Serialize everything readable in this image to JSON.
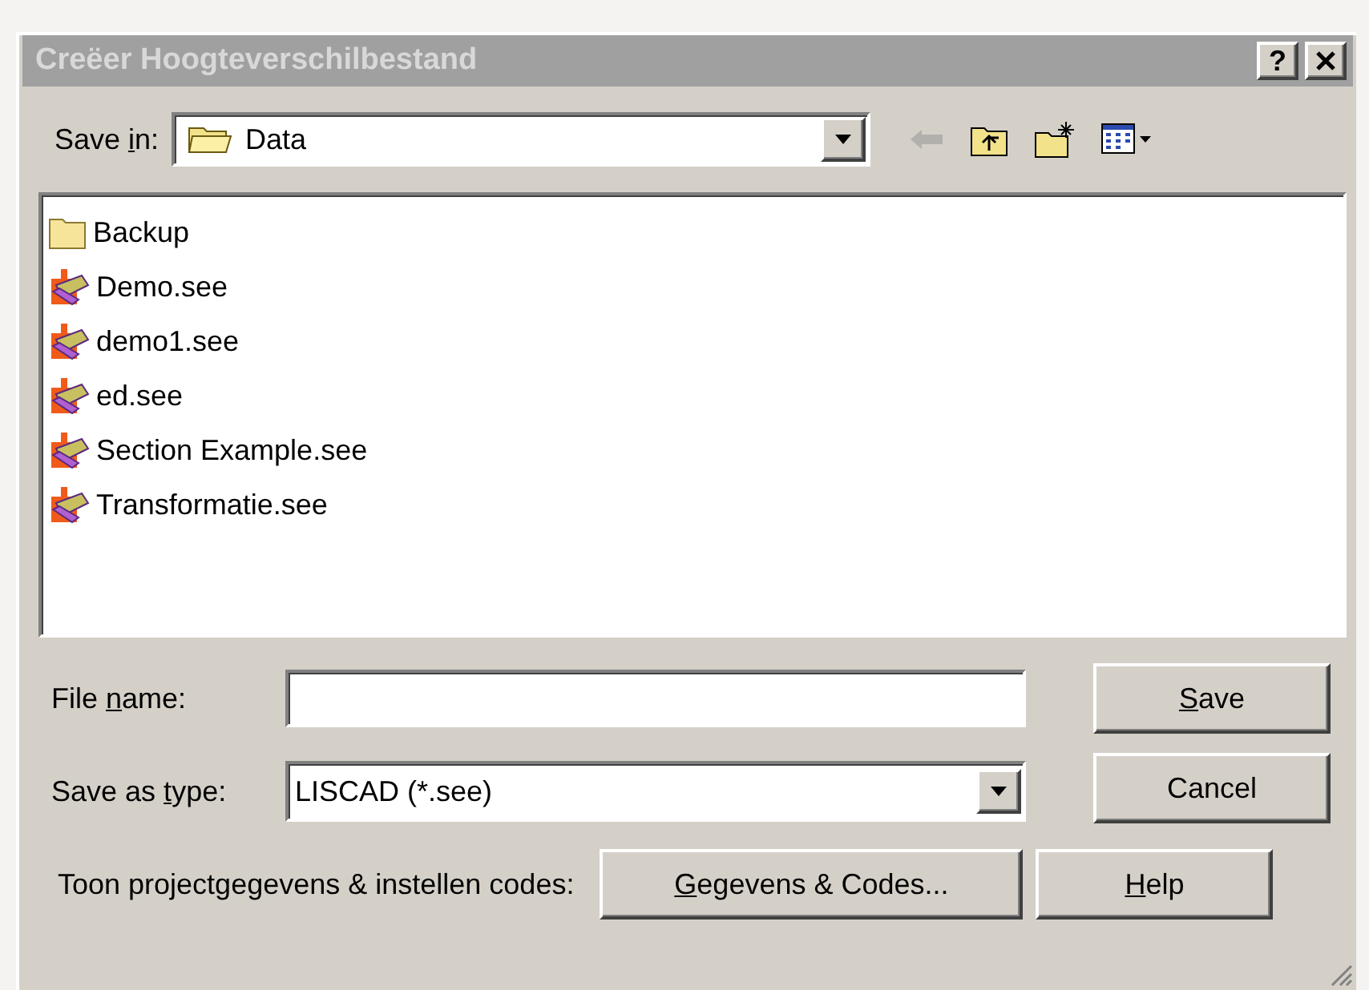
{
  "window": {
    "title": "Creëer Hoogteverschilbestand",
    "help": "?"
  },
  "save_in": {
    "label": {
      "pre": "Save ",
      "key": "i",
      "post": "n:"
    },
    "value": "Data"
  },
  "toolbar": [
    {
      "kind": "back",
      "disabled": true
    },
    {
      "kind": "up",
      "disabled": false
    },
    {
      "kind": "new_folder",
      "disabled": false
    },
    {
      "kind": "views",
      "disabled": false
    }
  ],
  "files": [
    {
      "name": "Backup",
      "kind": "folder"
    },
    {
      "name": "Demo.see",
      "kind": "file"
    },
    {
      "name": "demo1.see",
      "kind": "file"
    },
    {
      "name": "ed.see",
      "kind": "file"
    },
    {
      "name": "Section Example.see",
      "kind": "file"
    },
    {
      "name": "Transformatie.see",
      "kind": "file"
    }
  ],
  "file_name": {
    "label": {
      "pre": "File ",
      "key": "n",
      "post": "ame:"
    }
  },
  "save_as_type": {
    "label": {
      "pre": "Save as ",
      "key": "t",
      "post": "ype:"
    },
    "value": "LISCAD (*.see)"
  },
  "buttons": {
    "save": {
      "key": "S",
      "post": "ave"
    },
    "cancel": {
      "pre": "Cancel"
    }
  },
  "footer": {
    "label": "Toon projectgegevens & instellen codes:",
    "codes_button": {
      "key": "G",
      "post": "egevens & Codes..."
    },
    "help_button": {
      "key": "H",
      "post": "elp"
    }
  }
}
